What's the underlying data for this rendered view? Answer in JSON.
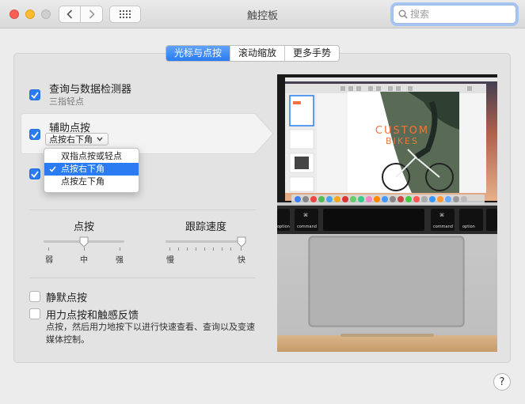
{
  "window": {
    "title": "触控板",
    "search_placeholder": "搜索"
  },
  "tabs": [
    {
      "label": "光标与点按",
      "active": true
    },
    {
      "label": "滚动缩放",
      "active": false
    },
    {
      "label": "更多手势",
      "active": false
    }
  ],
  "options": {
    "lookup": {
      "label": "查询与数据检测器",
      "sublabel": "三指轻点",
      "checked": true
    },
    "secondary_click": {
      "label": "辅助点按",
      "value": "点按右下角",
      "checked": true
    },
    "tap_to_click": {
      "checked": true
    },
    "silent_click": {
      "label": "静默点按",
      "checked": false
    },
    "force_click": {
      "label": "用力点按和触感反馈",
      "description": "点按，然后用力地按下以进行快速查看、查询以及变速媒体控制。",
      "checked": false
    }
  },
  "secondary_click_menu": [
    {
      "label": "双指点按或轻点",
      "selected": false
    },
    {
      "label": "点按右下角",
      "selected": true
    },
    {
      "label": "点按左下角",
      "selected": false
    }
  ],
  "click_slider": {
    "label": "点按",
    "min_label": "弱",
    "mid_label": "中",
    "max_label": "强",
    "value": 0.5
  },
  "tracking_slider": {
    "label": "跟踪速度",
    "min_label": "慢",
    "max_label": "快",
    "value": 1.0
  },
  "preview": {
    "poster_text_1": "CUSTOM",
    "poster_text_2": "BIKES",
    "touchbar_left": "option",
    "touchbar_cmd_left": "command",
    "touchbar_cmd_right": "command",
    "touchbar_right": "option"
  },
  "help_label": "?",
  "colors": {
    "accent": "#2b7cf2",
    "poster_orange": "#f0743a"
  },
  "icons": [
    "back-chevron",
    "forward-chevron",
    "grid-icon",
    "magnifier",
    "checkmark",
    "chevron-down",
    "help"
  ]
}
